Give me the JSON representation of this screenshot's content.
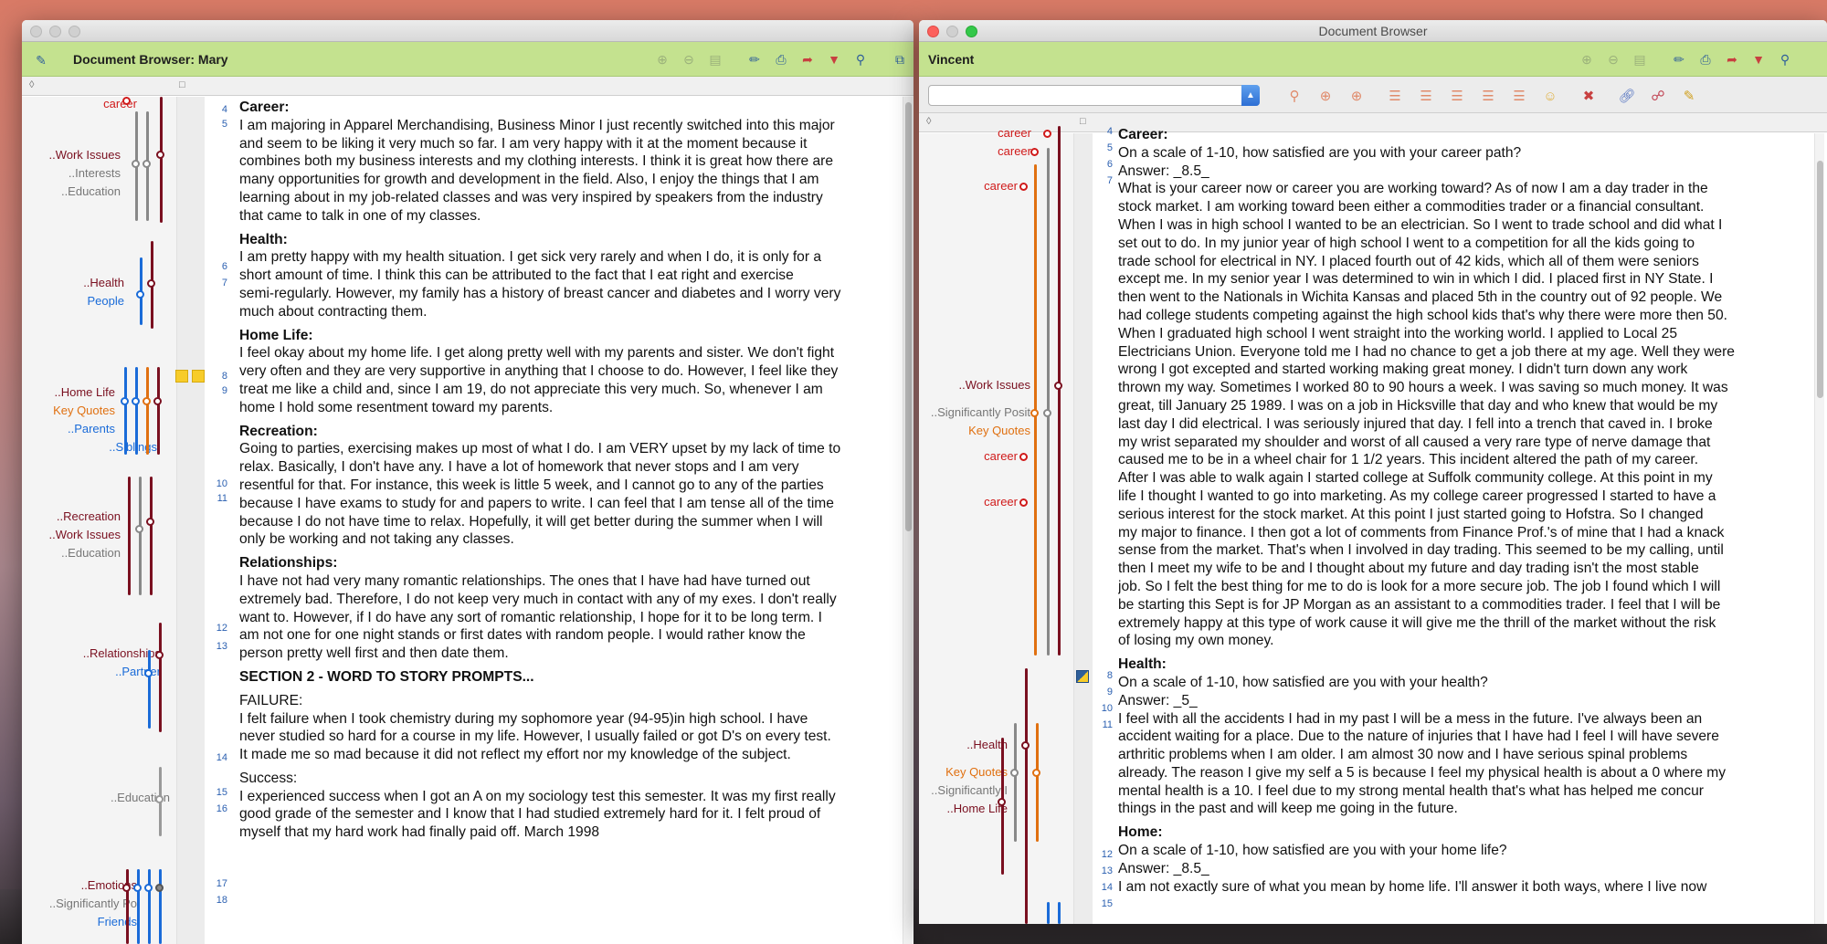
{
  "left": {
    "header_title": "Document Browser: Mary",
    "codes": [
      {
        "label": "career",
        "color": "red"
      },
      {
        "label": "..Work Issues",
        "color": "maroon"
      },
      {
        "label": "..Interests",
        "color": "gray"
      },
      {
        "label": "..Education",
        "color": "gray"
      },
      {
        "label": "..Health",
        "color": "maroon"
      },
      {
        "label": "People",
        "color": "blue"
      },
      {
        "label": "..Home Life",
        "color": "maroon"
      },
      {
        "label": "Key Quotes",
        "color": "orange"
      },
      {
        "label": "..Parents",
        "color": "blue"
      },
      {
        "label": "..Siblings",
        "color": "blue"
      },
      {
        "label": "..Recreation",
        "color": "maroon"
      },
      {
        "label": "..Work Issues",
        "color": "maroon"
      },
      {
        "label": "..Education",
        "color": "gray"
      },
      {
        "label": "..Relationships",
        "color": "maroon"
      },
      {
        "label": "..Partner",
        "color": "blue"
      },
      {
        "label": "..Education",
        "color": "gray"
      },
      {
        "label": "..Emotions",
        "color": "maroon"
      },
      {
        "label": "..Significantly Po",
        "color": "gray"
      },
      {
        "label": "Friends",
        "color": "blue"
      }
    ],
    "line_numbers": [
      "4",
      "5",
      "6",
      "7",
      "8",
      "9",
      "10",
      "11",
      "12",
      "13",
      "14",
      "15",
      "16",
      "17",
      "18"
    ],
    "paragraphs": [
      {
        "heading": "Career:",
        "lines": [
          "I am majoring in Apparel Merchandising, Business Minor I just recently switched into this major",
          "and seem to be liking it very much so far. I am very happy with it at the moment because it",
          "combines both my business interests and my clothing interests. I think it is great how there are",
          "many opportunities for growth and development in the field. Also, I enjoy the things that I am",
          "learning about in my job-related classes and was very inspired by speakers from the industry",
          "that came to talk in one of my classes."
        ]
      },
      {
        "heading": "Health:",
        "lines": [
          "I am pretty happy with my health situation. I get sick very rarely and when I do, it is only for a",
          "short amount of time. I think this can be attributed to the fact that I eat right and exercise",
          "semi-regularly. However, my family has a history of breast cancer and diabetes and I worry very",
          "much about contracting them."
        ]
      },
      {
        "heading": "Home Life:",
        "lines": [
          "I feel okay about my home life. I get along pretty well with my parents and sister. We don't fight",
          "very often and they are very supportive in anything that I choose to do. However, I feel like they",
          "treat me like a child and, since I am 19, do not appreciate this very much.  So, whenever I am",
          "home I hold some resentment toward my parents."
        ]
      },
      {
        "heading": "Recreation:",
        "lines": [
          "Going to parties, exercising makes up most of what I do. I am VERY upset by my lack of time to",
          "relax. Basically, I don't have any. I have a lot of homework that never stops and I am very",
          "resentful for that. For instance, this week is little 5 week, and I cannot go to any of the parties",
          "because I have exams to study for and papers to write. I can feel that I am tense all of the time",
          "because I do not have time to relax. Hopefully, it will get better during the summer when I will",
          "only be working and not taking any classes."
        ]
      },
      {
        "heading": "Relationships:",
        "lines": [
          "I have not had very many romantic relationships. The ones that I have had have turned out",
          "extremely bad. Therefore, I do not keep very much in contact with any of my exes. I don't really",
          "want to. However, if I do have any sort of romantic relationship, I hope for it to be long term. I",
          "am not one for one night stands or first dates with random people. I would rather know the",
          "person pretty well first and then date them."
        ]
      },
      {
        "heading": "SECTION 2 - WORD TO STORY PROMPTS...",
        "lines": []
      },
      {
        "heading": "",
        "lines": [
          "FAILURE:",
          "I felt failure when I took chemistry during my sophomore year (94-95)in high school. I have",
          "never studied so hard for a course in my life. However, I usually failed or got D's on every test.",
          "It made me so mad because it did not reflect my effort nor my knowledge of the subject."
        ]
      },
      {
        "heading": "",
        "lines": [
          "Success:",
          "I experienced success when I got an A on my sociology test this semester. It was my first really",
          "good grade of the semester and I know that I had studied extremely hard for it. I felt proud of",
          "myself that my hard work had finally paid off. March 1998"
        ]
      }
    ]
  },
  "right": {
    "window_title": "Document Browser",
    "header_title": "Vincent",
    "search_value": "",
    "codes": [
      {
        "label": "career",
        "color": "red"
      },
      {
        "label": "career",
        "color": "red"
      },
      {
        "label": "career",
        "color": "red"
      },
      {
        "label": "..Work Issues",
        "color": "maroon"
      },
      {
        "label": "..Significantly Posit",
        "color": "gray"
      },
      {
        "label": "Key Quotes",
        "color": "orange"
      },
      {
        "label": "career",
        "color": "red"
      },
      {
        "label": "career",
        "color": "red"
      },
      {
        "label": "..Health",
        "color": "maroon"
      },
      {
        "label": "Key Quotes",
        "color": "orange"
      },
      {
        "label": "..Significantly I",
        "color": "gray"
      },
      {
        "label": "..Home Life",
        "color": "maroon"
      }
    ],
    "line_numbers": [
      "4",
      "5",
      "6",
      "7",
      "8",
      "9",
      "10",
      "11",
      "12",
      "13",
      "14",
      "15"
    ],
    "paragraphs": [
      {
        "heading": "Career:",
        "lines": [
          "On a scale of 1-10, how satisfied are you with your career path?",
          "Answer: _8.5_",
          "What is your career now or career you are working toward? As of now I am a day trader in the",
          "stock market. I am working toward been either a commodities trader or a financial consultant.",
          "When I was in high school I wanted to be an electrician. So I went to trade school and did what I",
          "set out to do. In my junior year of high school I went to a competition for all the kids going to",
          "trade school for electrical in NY. I placed fourth out of 42 kids, which all of them were seniors",
          "except me. In my senior year I was determined to win in which I did. I placed first in NY State. I",
          "then went to the Nationals in Wichita Kansas and placed 5th in the country out of 92 people. We",
          "had college students competing against the high school kids that's why there were more then 50.",
          "When I graduated high school I went straight into the working world. I applied to Local 25",
          "Electricians Union. Everyone told me I had no chance to get a job there at my age. Well they were",
          "wrong I got excepted and started working making great money. I didn't turn down any work",
          "thrown my way. Sometimes I worked 80 to 90 hours a week. I was saving so much money. It was",
          "great, till January 25 1989. I was on a job in Hicksville that day and who knew that would be my",
          "last day I did electrical. I was seriously injured that day. I fell into a trench that caved in. I broke",
          "my wrist separated my shoulder and worst of all caused a very rare type of nerve damage that",
          "caused me to be in a wheel chair for 1 1/2 years. This incident altered the path of my career.",
          "After I was able to walk again I started college at Suffolk community college. At this point in my",
          "life I thought I wanted to go into marketing. As my college career progressed I started to have a",
          "serious interest for the stock market. At this point I just started going to Hofstra. So I changed",
          "my major to finance. I then got a lot of comments from Finance Prof.'s of mine that I had a knack",
          "sense from the market. That's when I involved in day trading. This seemed to be my calling, until",
          "then I meet my wife to be and I thought about my future and day trading isn't the most stable",
          "job. So I felt the best thing for me to do is look for a more secure job. The job I found which I will",
          "be starting this Sept is for JP Morgan as an assistant to a commodities trader. I feel that I will be",
          "extremely happy at this type of work cause it will give me the thrill of the market without the risk",
          "of losing my own money."
        ]
      },
      {
        "heading": "Health:",
        "lines": [
          "On a scale of 1-10, how satisfied are you with your health?",
          "Answer: _5_",
          "I feel with all the accidents I had in my past I will be a mess in the future. I've always been an",
          "accident waiting for a place. Due to the nature of injuries that I have had I feel I will have severe",
          "arthritic problems when I am older. I am almost 30 now and I have serious spinal problems",
          "already. The reason I give my self a 5 is because I feel my physical health is about a 0 where my",
          "mental health is a 10. I feel due to my strong mental health that's what has helped me concur",
          "things in the past and will keep me going in the future."
        ]
      },
      {
        "heading": "Home:",
        "lines": [
          "On a scale of 1-10, how satisfied are you with your home life?",
          "Answer: _8.5_",
          "I am not exactly sure of what you mean by home life. I'll answer it both ways, where I live now"
        ]
      }
    ]
  }
}
